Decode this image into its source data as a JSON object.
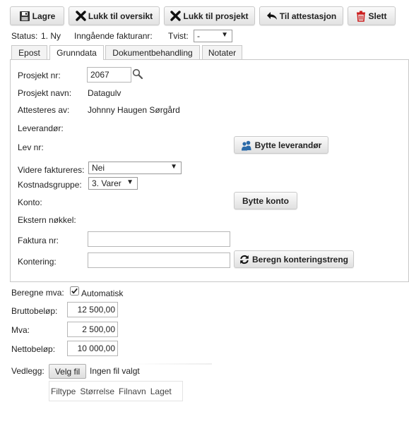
{
  "toolbar": {
    "save_label": "Lagre",
    "close_overview_label": "Lukk til oversikt",
    "close_project_label": "Lukk til prosjekt",
    "to_attestation_label": "Til attestasjon",
    "delete_label": "Slett"
  },
  "statusbar": {
    "status_label": "Status:",
    "status_value": "1. Ny",
    "incoming_label": "Inngående fakturanr:",
    "dispute_label": "Tvist:",
    "dispute_value": "-"
  },
  "tabs": [
    {
      "label": "Epost"
    },
    {
      "label": "Grunndata"
    },
    {
      "label": "Dokumentbehandling"
    },
    {
      "label": "Notater"
    }
  ],
  "form": {
    "project_no_label": "Prosjekt nr:",
    "project_no_value": "2067",
    "project_name_label": "Prosjekt navn:",
    "project_name_value": "Datagulv",
    "attested_by_label": "Attesteres av:",
    "attested_by_value": "Johnny Haugen Sørgård",
    "supplier_label": "Leverandør:",
    "supplier_no_label": "Lev nr:",
    "change_supplier_label": "Bytte leverandør",
    "reinvoice_label": "Videre faktureres:",
    "reinvoice_value": "Nei",
    "cost_group_label": "Kostnadsgruppe:",
    "cost_group_value": "3. Varer",
    "account_label": "Konto:",
    "change_account_label": "Bytte konto",
    "external_key_label": "Ekstern nøkkel:",
    "invoice_no_label": "Faktura nr:",
    "invoice_no_value": "",
    "posting_label": "Kontering:",
    "posting_value": "",
    "calc_posting_label": "Beregn konteringstreng"
  },
  "totals": {
    "vat_calc_label": "Beregne mva:",
    "automatic_label": "Automatisk",
    "automatic_checked": true,
    "gross_label": "Bruttobeløp:",
    "gross_value": "12 500,00",
    "vat_label": "Mva:",
    "vat_value": "2 500,00",
    "net_label": "Nettobeløp:",
    "net_value": "10 000,00"
  },
  "attachments": {
    "label": "Vedlegg:",
    "choose_file_label": "Velg fil",
    "no_file_label": "Ingen fil valgt",
    "columns": [
      "Filtype",
      "Størrelse",
      "Filnavn",
      "Laget"
    ]
  },
  "colors": {
    "delete_icon": "#cc1f1f",
    "user_icon": "#2b6aa8",
    "button_top": "#fbfbfb",
    "button_bottom": "#e2e2e2"
  }
}
